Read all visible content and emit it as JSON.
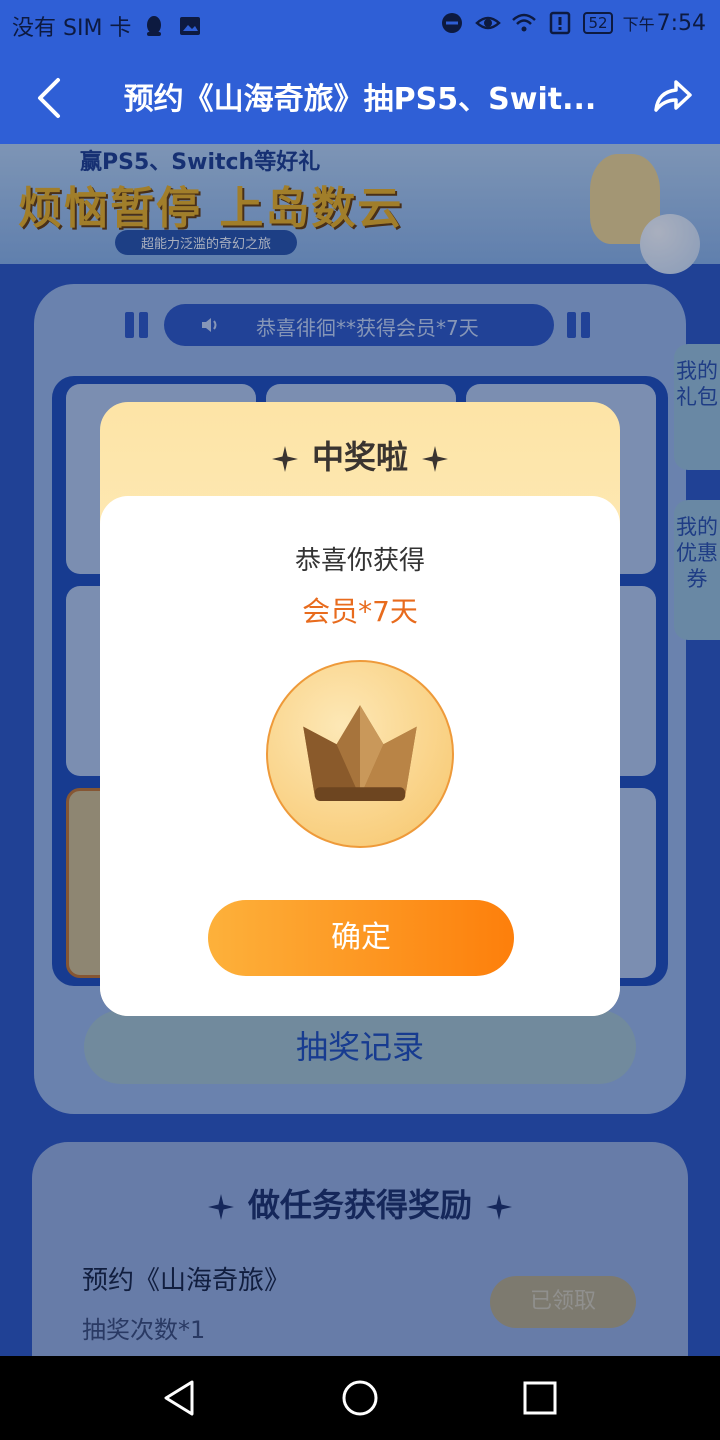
{
  "status_bar": {
    "carrier": "没有 SIM 卡",
    "battery": "52",
    "time_prefix": "下午",
    "time": "7:54"
  },
  "navbar": {
    "title": "预约《山海奇旅》抽PS5、Swit..."
  },
  "banner": {
    "headline": "烦恼暂停 上岛数云",
    "subline": "超能力泛滥的奇幻之旅",
    "top_text": "赢PS5、Switch等好礼"
  },
  "ticker": {
    "text": "恭喜徘徊**获得会员*7天"
  },
  "lottery": {
    "record_button": "抽奖记录"
  },
  "side_tabs": {
    "gifts": "我的礼包",
    "coupons": "我的优惠券"
  },
  "task_section": {
    "title": "做任务获得奖励",
    "task_name": "预约《山海奇旅》",
    "task_desc": "抽奖次数*1",
    "task_button": "已领取"
  },
  "modal": {
    "heading": "中奖啦",
    "congrats": "恭喜你获得",
    "prize": "会员*7天",
    "confirm": "确定",
    "medal_icon": "crown-icon"
  },
  "colors": {
    "brand_blue": "#2f5fd6",
    "prize_orange": "#e86b1d",
    "button_gradient_start": "#fdb13b",
    "button_gradient_end": "#fd7f0b"
  }
}
